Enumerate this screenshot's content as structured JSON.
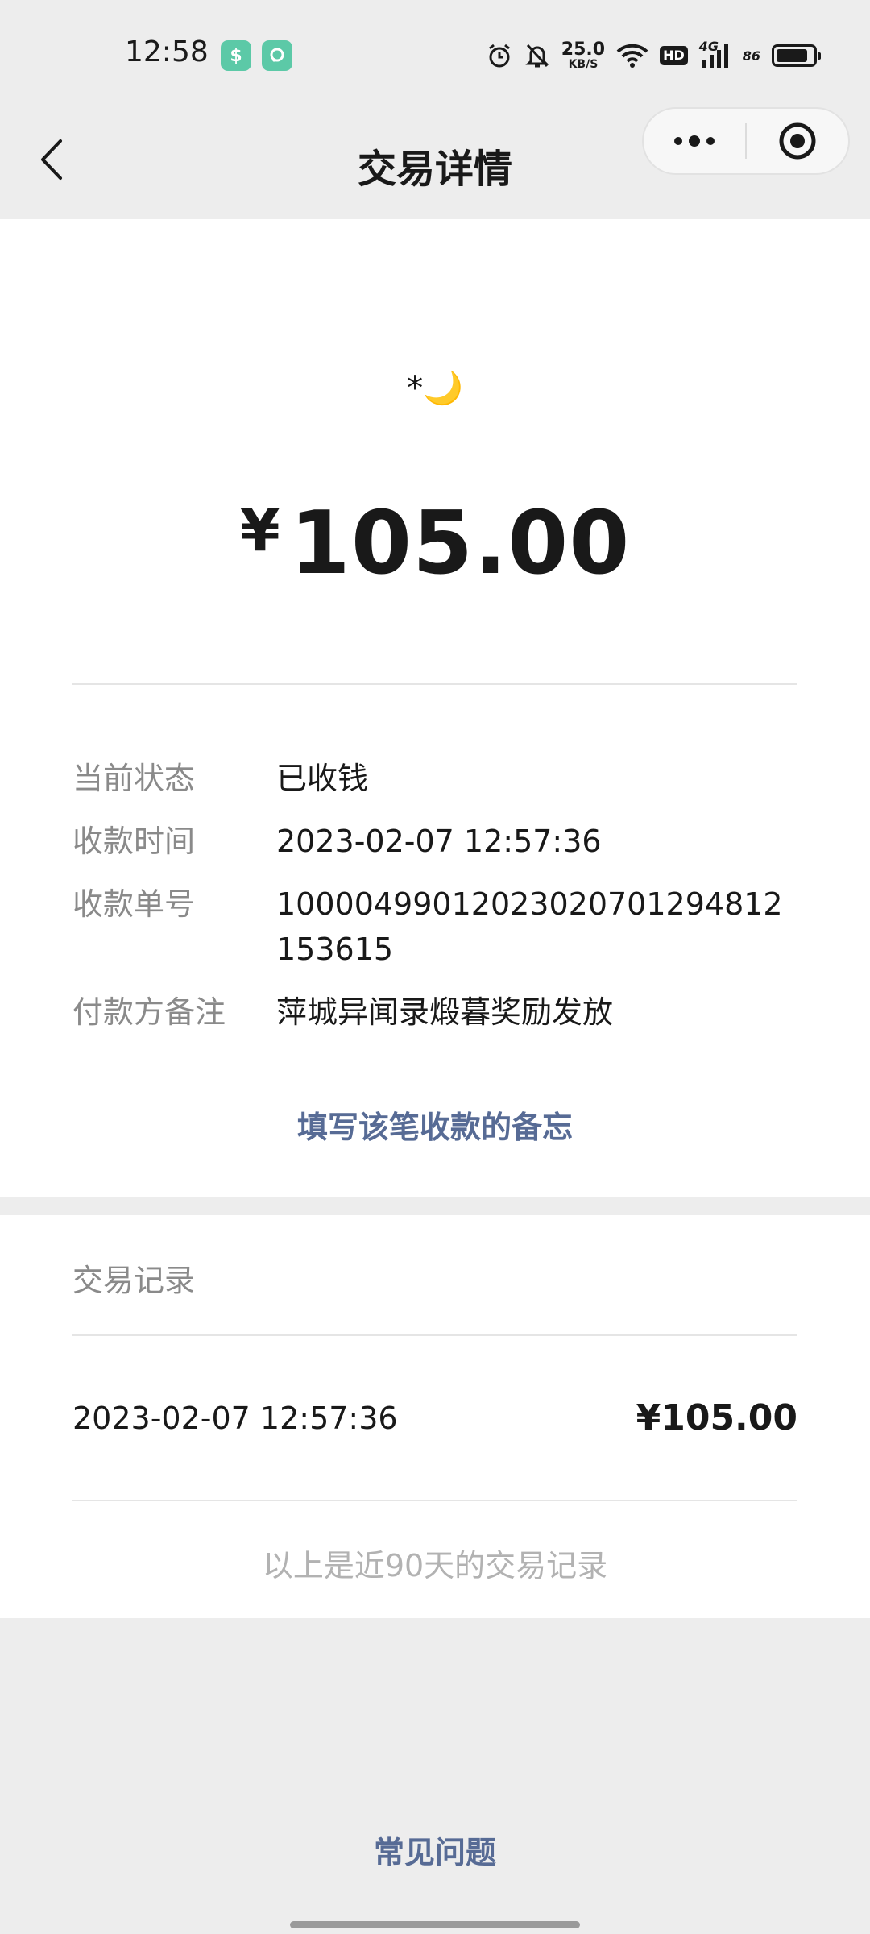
{
  "status_bar": {
    "time": "12:58",
    "net_speed_value": "25.0",
    "net_speed_unit": "KB/S",
    "hd_label": "HD",
    "signal_label": "4G",
    "battery_label": "86",
    "battery_level": 0.86,
    "icons": [
      "app-notification-icon",
      "chat-notification-icon",
      "alarm-icon",
      "mute-icon",
      "wifi-icon",
      "signal-icon",
      "battery-icon"
    ]
  },
  "nav": {
    "title": "交易详情",
    "back_icon": "chevron-left-icon",
    "more_icon": "more-dots-icon",
    "close_icon": "target-close-icon"
  },
  "transaction": {
    "payer_name": "*🌙",
    "currency_symbol": "¥",
    "amount": "105.00",
    "details": [
      {
        "label": "当前状态",
        "value": "已收钱"
      },
      {
        "label": "收款时间",
        "value": "2023-02-07 12:57:36"
      },
      {
        "label": "收款单号",
        "value": "10000499012023020701294812153615"
      },
      {
        "label": "付款方备注",
        "value": "萍城异闻录煅暮奖励发放"
      }
    ],
    "memo_link": "填写该笔收款的备忘"
  },
  "records": {
    "title": "交易记录",
    "items": [
      {
        "date": "2023-02-07 12:57:36",
        "amount": "¥105.00"
      }
    ],
    "note": "以上是近90天的交易记录"
  },
  "faq_link": "常见问题",
  "colors": {
    "background": "#ededed",
    "card": "#ffffff",
    "link": "#576b95",
    "label": "#8a8a8a",
    "text": "#191919"
  }
}
